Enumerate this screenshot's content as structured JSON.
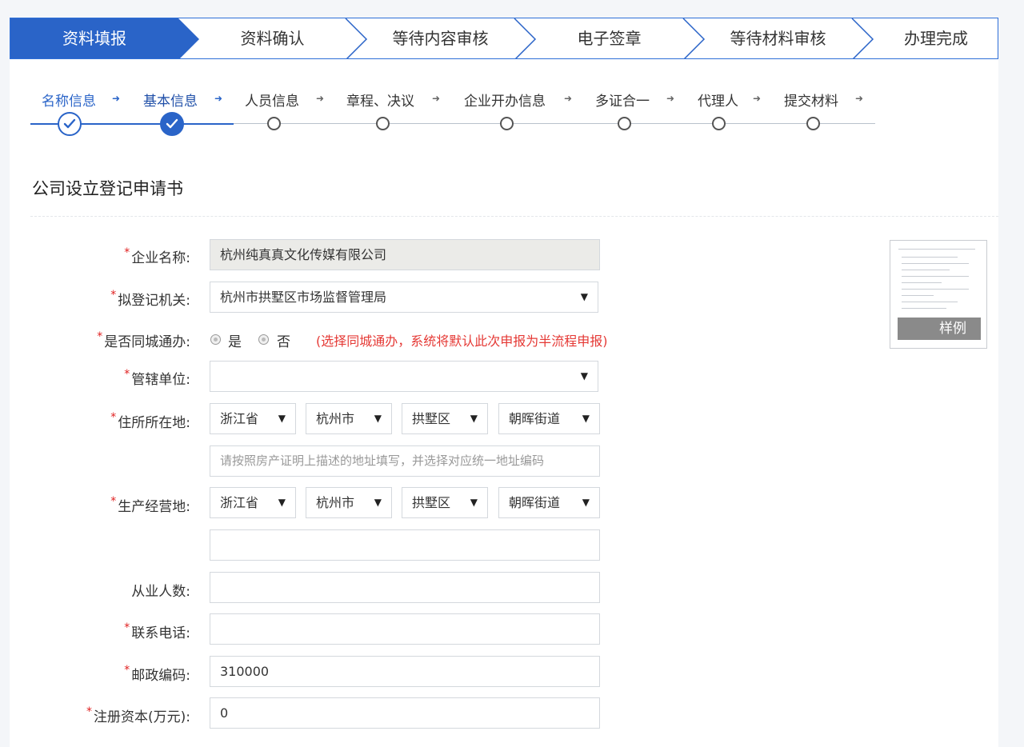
{
  "process_steps": [
    {
      "label": "资料填报",
      "active": true
    },
    {
      "label": "资料确认",
      "active": false
    },
    {
      "label": "等待内容审核",
      "active": false
    },
    {
      "label": "电子签章",
      "active": false
    },
    {
      "label": "等待材料审核",
      "active": false
    },
    {
      "label": "办理完成",
      "active": false
    }
  ],
  "sub_steps": [
    {
      "label": "名称信息",
      "status": "done"
    },
    {
      "label": "基本信息",
      "status": "current"
    },
    {
      "label": "人员信息",
      "status": "pending"
    },
    {
      "label": "章程、决议",
      "status": "pending"
    },
    {
      "label": "企业开办信息",
      "status": "pending"
    },
    {
      "label": "多证合一",
      "status": "pending"
    },
    {
      "label": "代理人",
      "status": "pending"
    },
    {
      "label": "提交材料",
      "status": "pending"
    }
  ],
  "form_title": "公司设立登记申请书",
  "required_mark": "*",
  "arrow_glyph": "➜",
  "fields": {
    "company_name": {
      "label": "企业名称:",
      "value": "杭州纯真真文化传媒有限公司"
    },
    "registration_authority": {
      "label": "拟登记机关:",
      "value": "杭州市拱墅区市场监督管理局"
    },
    "same_city": {
      "label": "是否同城通办:",
      "option_yes": "是",
      "option_no": "否",
      "hint": "(选择同城通办，系统将默认此次申报为半流程申报)"
    },
    "jurisdiction": {
      "label": "管辖单位:",
      "value": ""
    },
    "residence": {
      "label": "住所所在地:",
      "province": "浙江省",
      "city": "杭州市",
      "district": "拱墅区",
      "street": "朝晖街道",
      "address_placeholder": "请按照房产证明上描述的地址填写，并选择对应统一地址编码"
    },
    "business_place": {
      "label": "生产经营地:",
      "province": "浙江省",
      "city": "杭州市",
      "district": "拱墅区",
      "street": "朝晖街道",
      "address": ""
    },
    "employees": {
      "label": "从业人数:",
      "value": ""
    },
    "phone": {
      "label": "联系电话:",
      "value": ""
    },
    "postal_code": {
      "label": "邮政编码:",
      "value": "310000"
    },
    "capital": {
      "label": "注册资本(万元):",
      "value": "0"
    }
  },
  "sample_badge": "样例",
  "dropdown_caret": "▼"
}
